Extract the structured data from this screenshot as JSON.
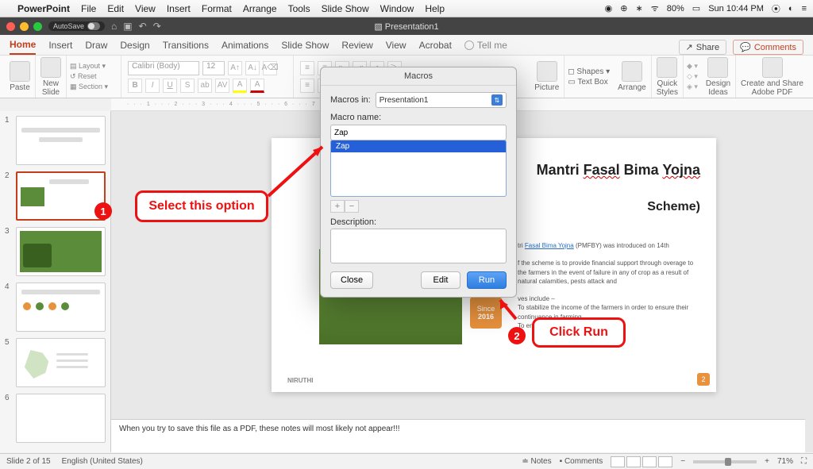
{
  "menubar": {
    "app": "PowerPoint",
    "items": [
      "File",
      "Edit",
      "View",
      "Insert",
      "Format",
      "Arrange",
      "Tools",
      "Slide Show",
      "Window",
      "Help"
    ],
    "battery": "80%",
    "clock": "Sun 10:44 PM"
  },
  "titlebar": {
    "autosave": "AutoSave",
    "doc": "Presentation1"
  },
  "ribbon": {
    "tabs": [
      "Home",
      "Insert",
      "Draw",
      "Design",
      "Transitions",
      "Animations",
      "Slide Show",
      "Review",
      "View",
      "Acrobat"
    ],
    "tellme": "Tell me",
    "share": "Share",
    "comments": "Comments",
    "paste": "Paste",
    "newslide": "New\nSlide",
    "layout": "Layout",
    "reset": "Reset",
    "section": "Section",
    "font_name": "Calibri (Body)",
    "font_size": "12",
    "picture": "Picture",
    "textbox": "Text Box",
    "shapes": "Shapes",
    "arrange": "Arrange",
    "quick": "Quick\nStyles",
    "design_ideas": "Design\nIdeas",
    "adobe": "Create and Share\nAdobe PDF"
  },
  "dialog": {
    "title": "Macros",
    "macros_in_label": "Macros in:",
    "macros_in_value": "Presentation1",
    "name_label": "Macro name:",
    "name_value": "Zap",
    "list_item": "Zap",
    "desc_label": "Description:",
    "close": "Close",
    "edit": "Edit",
    "run": "Run"
  },
  "slide": {
    "title_a": "Mantri ",
    "title_b": "Fasal",
    "title_c": " Bima ",
    "title_d": "Yojna",
    "subtitle": "Scheme)",
    "body1_a": "tri ",
    "body1_b": "Fasal Bima Yojna",
    "body1_c": " (PMFBY) was introduced on 14th",
    "body2": "f the scheme is to provide financial support through overage to the farmers in the event of failure in any of crop as a result of natural calamities, pests attack and",
    "body3": "ves include –\nTo stabilize the income of the farmers in order to ensure their continuance in farming\nTo encourage ...",
    "since": "Since",
    "year": "2016",
    "logo": "NIRUTHI",
    "page": "2"
  },
  "notes": "When you try to save this file as a PDF, these notes will most likely not appear!!!",
  "annotations": {
    "a1": "Select this option",
    "n1": "1",
    "a2": "Click Run",
    "n2": "2"
  },
  "status": {
    "slide": "Slide 2 of 15",
    "lang": "English (United States)",
    "notes": "Notes",
    "comments": "Comments",
    "zoom": "71%"
  }
}
